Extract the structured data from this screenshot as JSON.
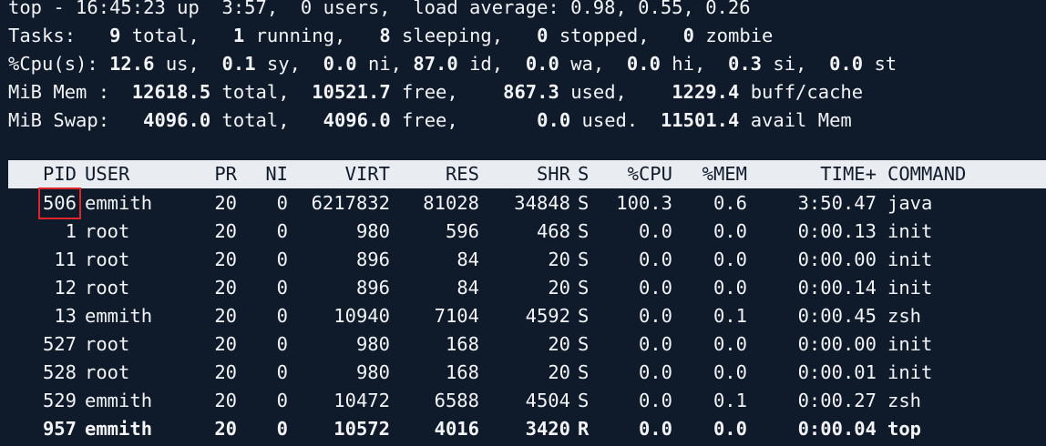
{
  "summary": {
    "l1": [
      "top - 16:45:23 up  3:57,  0 users,  load average: 0.98, 0.55, 0.26"
    ],
    "tasks": {
      "label": "Tasks:",
      "total": "9",
      "total_l": "total,",
      "running": "1",
      "running_l": "running,",
      "sleeping": "8",
      "sleeping_l": "sleeping,",
      "stopped": "0",
      "stopped_l": "stopped,",
      "zombie": "0",
      "zombie_l": "zombie"
    },
    "cpu": {
      "label": "%Cpu(s):",
      "us": "12.6",
      "us_l": "us,",
      "sy": "0.1",
      "sy_l": "sy,",
      "ni": "0.0",
      "ni_l": "ni,",
      "id": "87.0",
      "id_l": "id,",
      "wa": "0.0",
      "wa_l": "wa,",
      "hi": "0.0",
      "hi_l": "hi,",
      "si": "0.3",
      "si_l": "si,",
      "st": "0.0",
      "st_l": "st"
    },
    "mem": {
      "label": "MiB Mem :",
      "total": "12618.5",
      "total_l": "total,",
      "free": "10521.7",
      "free_l": "free,",
      "used": "867.3",
      "used_l": "used,",
      "buff": "1229.4",
      "buff_l": "buff/cache"
    },
    "swap": {
      "label": "MiB Swap:",
      "total": "4096.0",
      "total_l": "total,",
      "free": "4096.0",
      "free_l": "free,",
      "used": "0.0",
      "used_l": "used.",
      "avail": "11501.4",
      "avail_l": "avail Mem"
    }
  },
  "columns": [
    "PID",
    "USER",
    "PR",
    "NI",
    "VIRT",
    "RES",
    "SHR",
    "S",
    "%CPU",
    "%MEM",
    "TIME+",
    "COMMAND"
  ],
  "processes": [
    {
      "pid": "506",
      "user": "emmith",
      "pr": "20",
      "ni": "0",
      "virt": "6217832",
      "res": "81028",
      "shr": "34848",
      "s": "S",
      "cpu": "100.3",
      "mem": "0.6",
      "time": "3:50.47",
      "cmd": "java"
    },
    {
      "pid": "1",
      "user": "root",
      "pr": "20",
      "ni": "0",
      "virt": "980",
      "res": "596",
      "shr": "468",
      "s": "S",
      "cpu": "0.0",
      "mem": "0.0",
      "time": "0:00.13",
      "cmd": "init"
    },
    {
      "pid": "11",
      "user": "root",
      "pr": "20",
      "ni": "0",
      "virt": "896",
      "res": "84",
      "shr": "20",
      "s": "S",
      "cpu": "0.0",
      "mem": "0.0",
      "time": "0:00.00",
      "cmd": "init"
    },
    {
      "pid": "12",
      "user": "root",
      "pr": "20",
      "ni": "0",
      "virt": "896",
      "res": "84",
      "shr": "20",
      "s": "S",
      "cpu": "0.0",
      "mem": "0.0",
      "time": "0:00.14",
      "cmd": "init"
    },
    {
      "pid": "13",
      "user": "emmith",
      "pr": "20",
      "ni": "0",
      "virt": "10940",
      "res": "7104",
      "shr": "4592",
      "s": "S",
      "cpu": "0.0",
      "mem": "0.1",
      "time": "0:00.45",
      "cmd": "zsh"
    },
    {
      "pid": "527",
      "user": "root",
      "pr": "20",
      "ni": "0",
      "virt": "980",
      "res": "168",
      "shr": "20",
      "s": "S",
      "cpu": "0.0",
      "mem": "0.0",
      "time": "0:00.00",
      "cmd": "init"
    },
    {
      "pid": "528",
      "user": "root",
      "pr": "20",
      "ni": "0",
      "virt": "980",
      "res": "168",
      "shr": "20",
      "s": "S",
      "cpu": "0.0",
      "mem": "0.0",
      "time": "0:00.01",
      "cmd": "init"
    },
    {
      "pid": "529",
      "user": "emmith",
      "pr": "20",
      "ni": "0",
      "virt": "10472",
      "res": "6588",
      "shr": "4504",
      "s": "S",
      "cpu": "0.0",
      "mem": "0.1",
      "time": "0:00.27",
      "cmd": "zsh"
    },
    {
      "pid": "957",
      "user": "emmith",
      "pr": "20",
      "ni": "0",
      "virt": "10572",
      "res": "4016",
      "shr": "3420",
      "s": "R",
      "cpu": "0.0",
      "mem": "0.0",
      "time": "0:00.04",
      "cmd": "top"
    }
  ],
  "highlight_color": "#e0262a"
}
